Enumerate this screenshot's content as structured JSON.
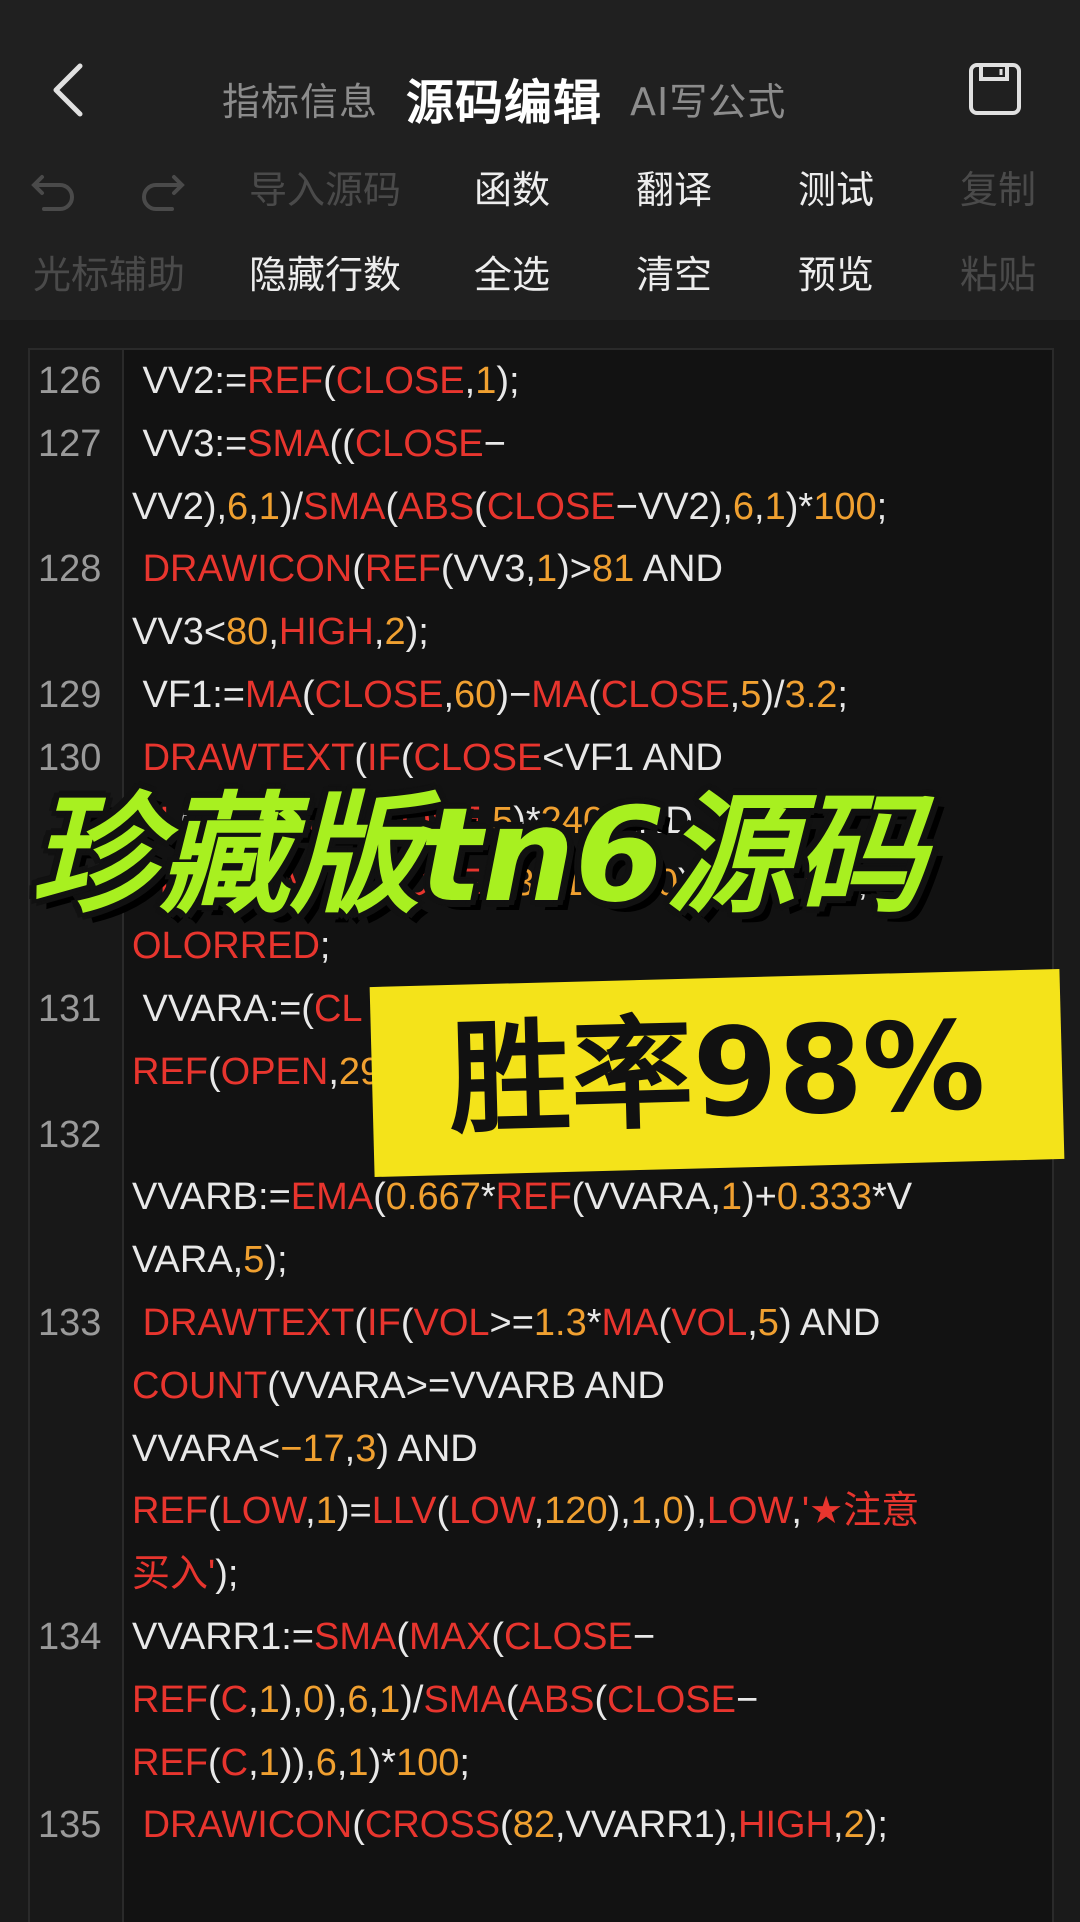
{
  "header": {
    "tabs": [
      {
        "label": "指标信息"
      },
      {
        "label": "源码编辑"
      },
      {
        "label": "AI写公式"
      }
    ]
  },
  "toolbar": {
    "row1": [
      "导入源码",
      "函数",
      "翻译",
      "测试",
      "复制"
    ],
    "row2": [
      "光标辅助",
      "隐藏行数",
      "全选",
      "清空",
      "预览",
      "粘贴"
    ]
  },
  "editor": {
    "lines": [
      {
        "ln": "126",
        "segs": [
          [
            " VV2:=",
            "w"
          ],
          [
            "REF",
            "r"
          ],
          [
            "(",
            "w"
          ],
          [
            "CLOSE",
            "r"
          ],
          [
            ",",
            "w"
          ],
          [
            "1",
            "o"
          ],
          [
            ");",
            "w"
          ]
        ]
      },
      {
        "ln": "127",
        "segs": [
          [
            " VV3:=",
            "w"
          ],
          [
            "SMA",
            "r"
          ],
          [
            "((",
            "w"
          ],
          [
            "CLOSE",
            "r"
          ],
          [
            "−",
            "w"
          ]
        ]
      },
      {
        "ln": "",
        "segs": [
          [
            "VV2),",
            "w"
          ],
          [
            "6",
            "o"
          ],
          [
            ",",
            "w"
          ],
          [
            "1",
            "o"
          ],
          [
            ")/",
            "w"
          ],
          [
            "SMA",
            "r"
          ],
          [
            "(",
            "w"
          ],
          [
            "ABS",
            "r"
          ],
          [
            "(",
            "w"
          ],
          [
            "CLOSE",
            "r"
          ],
          [
            "−VV2),",
            "w"
          ],
          [
            "6",
            "o"
          ],
          [
            ",",
            "w"
          ],
          [
            "1",
            "o"
          ],
          [
            ")*",
            "w"
          ],
          [
            "100",
            "o"
          ],
          [
            ";",
            "w"
          ]
        ]
      },
      {
        "ln": "128",
        "segs": [
          [
            " ",
            "w"
          ],
          [
            "DRAWICON",
            "r"
          ],
          [
            "(",
            "w"
          ],
          [
            "REF",
            "r"
          ],
          [
            "(VV3,",
            "w"
          ],
          [
            "1",
            "o"
          ],
          [
            ")>",
            "w"
          ],
          [
            "81",
            "o"
          ],
          [
            " AND",
            "w"
          ]
        ]
      },
      {
        "ln": "",
        "segs": [
          [
            "VV3<",
            "w"
          ],
          [
            "80",
            "o"
          ],
          [
            ",",
            "w"
          ],
          [
            "HIGH",
            "r"
          ],
          [
            ",",
            "w"
          ],
          [
            "2",
            "o"
          ],
          [
            ");",
            "w"
          ]
        ]
      },
      {
        "ln": "129",
        "segs": [
          [
            " VF1:=",
            "w"
          ],
          [
            "MA",
            "r"
          ],
          [
            "(",
            "w"
          ],
          [
            "CLOSE",
            "r"
          ],
          [
            ",",
            "w"
          ],
          [
            "60",
            "o"
          ],
          [
            ")−",
            "w"
          ],
          [
            "MA",
            "r"
          ],
          [
            "(",
            "w"
          ],
          [
            "CLOSE",
            "r"
          ],
          [
            ",",
            "w"
          ],
          [
            "5",
            "o"
          ],
          [
            ")/",
            "w"
          ],
          [
            "3.2",
            "o"
          ],
          [
            ";",
            "w"
          ]
        ]
      },
      {
        "ln": "130",
        "segs": [
          [
            " ",
            "w"
          ],
          [
            "DRAWTEXT",
            "r"
          ],
          [
            "(",
            "w"
          ],
          [
            "IF",
            "r"
          ],
          [
            "(",
            "w"
          ],
          [
            "CLOSE",
            "r"
          ],
          [
            "<VF1 AND",
            "w"
          ]
        ]
      },
      {
        "ln": "",
        "segs": [
          [
            "CL",
            "r"
          ],
          [
            "OSE<",
            "w"
          ],
          [
            "MA",
            "r"
          ],
          [
            "(",
            "w"
          ],
          [
            "CLOSE",
            "r"
          ],
          [
            ",",
            "w"
          ],
          [
            "5",
            "o"
          ],
          [
            ")*",
            "w"
          ],
          [
            "240",
            "o"
          ],
          [
            " AND",
            "w"
          ]
        ]
      },
      {
        "ln": "",
        "segs": [
          [
            "CLOSE",
            "r"
          ],
          [
            "<",
            "w"
          ],
          [
            "MA",
            "r"
          ],
          [
            "(",
            "w"
          ],
          [
            "CLOSE",
            "r"
          ],
          [
            ",",
            "w"
          ],
          [
            "13",
            "o"
          ],
          [
            ")*",
            "w"
          ],
          [
            "1.3",
            "o"
          ],
          [
            ",",
            "w"
          ],
          [
            "1",
            "o"
          ],
          [
            ",",
            "w"
          ],
          [
            "0",
            "o"
          ],
          [
            "),",
            "w"
          ],
          [
            "LOW",
            "r"
          ],
          [
            ",",
            "w"
          ],
          [
            "'☆'",
            "r"
          ],
          [
            "),",
            "w"
          ],
          [
            "C",
            "r"
          ]
        ]
      },
      {
        "ln": "",
        "segs": [
          [
            "OLORRED",
            "r"
          ],
          [
            ";",
            "w"
          ]
        ]
      },
      {
        "ln": "131",
        "segs": [
          [
            " VVARA:=(",
            "w"
          ],
          [
            "CL",
            "r"
          ]
        ]
      },
      {
        "ln": "",
        "segs": [
          [
            "REF",
            "r"
          ],
          [
            "(",
            "w"
          ],
          [
            "OPEN",
            "r"
          ],
          [
            ",",
            "w"
          ],
          [
            "29",
            "o"
          ]
        ]
      },
      {
        "ln": "132",
        "segs": [
          [
            "",
            "w"
          ]
        ]
      },
      {
        "ln": "",
        "segs": [
          [
            "VVARB:=",
            "w"
          ],
          [
            "EMA",
            "r"
          ],
          [
            "(",
            "w"
          ],
          [
            "0.667",
            "o"
          ],
          [
            "*",
            "w"
          ],
          [
            "REF",
            "r"
          ],
          [
            "(VVARA,",
            "w"
          ],
          [
            "1",
            "o"
          ],
          [
            ")+",
            "w"
          ],
          [
            "0.333",
            "o"
          ],
          [
            "*V",
            "w"
          ]
        ]
      },
      {
        "ln": "",
        "segs": [
          [
            "VARA,",
            "w"
          ],
          [
            "5",
            "o"
          ],
          [
            ");",
            "w"
          ]
        ]
      },
      {
        "ln": "133",
        "segs": [
          [
            " ",
            "w"
          ],
          [
            "DRAWTEXT",
            "r"
          ],
          [
            "(",
            "w"
          ],
          [
            "IF",
            "r"
          ],
          [
            "(",
            "w"
          ],
          [
            "VOL",
            "r"
          ],
          [
            ">=",
            "w"
          ],
          [
            "1.3",
            "o"
          ],
          [
            "*",
            "w"
          ],
          [
            "MA",
            "r"
          ],
          [
            "(",
            "w"
          ],
          [
            "VOL",
            "r"
          ],
          [
            ",",
            "w"
          ],
          [
            "5",
            "o"
          ],
          [
            ") AND",
            "w"
          ]
        ]
      },
      {
        "ln": "",
        "segs": [
          [
            "COUNT",
            "r"
          ],
          [
            "(VVARA>=VVARB AND",
            "w"
          ]
        ]
      },
      {
        "ln": "",
        "segs": [
          [
            "VVARA<",
            "w"
          ],
          [
            "−17",
            "o"
          ],
          [
            ",",
            "w"
          ],
          [
            "3",
            "o"
          ],
          [
            ") AND",
            "w"
          ]
        ]
      },
      {
        "ln": "",
        "segs": [
          [
            "REF",
            "r"
          ],
          [
            "(",
            "w"
          ],
          [
            "LOW",
            "r"
          ],
          [
            ",",
            "w"
          ],
          [
            "1",
            "o"
          ],
          [
            ")=",
            "w"
          ],
          [
            "LLV",
            "r"
          ],
          [
            "(",
            "w"
          ],
          [
            "LOW",
            "r"
          ],
          [
            ",",
            "w"
          ],
          [
            "120",
            "o"
          ],
          [
            "),",
            "w"
          ],
          [
            "1",
            "o"
          ],
          [
            ",",
            "w"
          ],
          [
            "0",
            "o"
          ],
          [
            "),",
            "w"
          ],
          [
            "LOW",
            "r"
          ],
          [
            ",",
            "w"
          ],
          [
            "'★注意",
            "r"
          ]
        ]
      },
      {
        "ln": "",
        "segs": [
          [
            "买入'",
            "r"
          ],
          [
            ");",
            "w"
          ]
        ]
      },
      {
        "ln": "134",
        "segs": [
          [
            "VVARR1:=",
            "w"
          ],
          [
            "SMA",
            "r"
          ],
          [
            "(",
            "w"
          ],
          [
            "MAX",
            "r"
          ],
          [
            "(",
            "w"
          ],
          [
            "CLOSE",
            "r"
          ],
          [
            "−",
            "w"
          ]
        ]
      },
      {
        "ln": "",
        "segs": [
          [
            "REF",
            "r"
          ],
          [
            "(",
            "w"
          ],
          [
            "C",
            "r"
          ],
          [
            ",",
            "w"
          ],
          [
            "1",
            "o"
          ],
          [
            "),",
            "w"
          ],
          [
            "0",
            "o"
          ],
          [
            "),",
            "w"
          ],
          [
            "6",
            "o"
          ],
          [
            ",",
            "w"
          ],
          [
            "1",
            "o"
          ],
          [
            ")/",
            "w"
          ],
          [
            "SMA",
            "r"
          ],
          [
            "(",
            "w"
          ],
          [
            "ABS",
            "r"
          ],
          [
            "(",
            "w"
          ],
          [
            "CLOSE",
            "r"
          ],
          [
            "−",
            "w"
          ]
        ]
      },
      {
        "ln": "",
        "segs": [
          [
            "REF",
            "r"
          ],
          [
            "(",
            "w"
          ],
          [
            "C",
            "r"
          ],
          [
            ",",
            "w"
          ],
          [
            "1",
            "o"
          ],
          [
            ")),",
            "w"
          ],
          [
            "6",
            "o"
          ],
          [
            ",",
            "w"
          ],
          [
            "1",
            "o"
          ],
          [
            ")*",
            "w"
          ],
          [
            "100",
            "o"
          ],
          [
            ";",
            "w"
          ]
        ]
      },
      {
        "ln": "135",
        "segs": [
          [
            " ",
            "w"
          ],
          [
            "DRAWICON",
            "r"
          ],
          [
            "(",
            "w"
          ],
          [
            "CROSS",
            "r"
          ],
          [
            "(",
            "w"
          ],
          [
            "82",
            "o"
          ],
          [
            ",VVARR1),",
            "w"
          ],
          [
            "HIGH",
            "r"
          ],
          [
            ",",
            "w"
          ],
          [
            "2",
            "o"
          ],
          [
            ");",
            "w"
          ]
        ]
      }
    ]
  },
  "overlay": {
    "title": "珍藏版tn6源码",
    "subtitle": "胜率98%"
  },
  "colors": {
    "keyword": "#e8352e",
    "number": "#f0a030",
    "text": "#e8e8e8",
    "banner_green": "#a8f020",
    "banner_yellow": "#f4e31a"
  }
}
